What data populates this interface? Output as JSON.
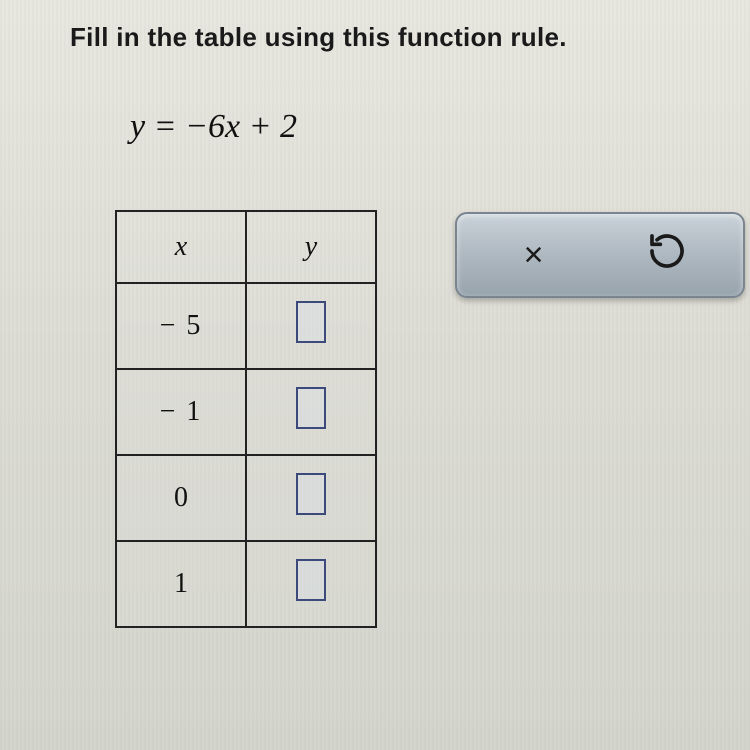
{
  "instruction": "Fill in the table using this function rule.",
  "equation": "y = −6x + 2",
  "table": {
    "headers": {
      "x": "x",
      "y": "y"
    },
    "rows": [
      {
        "x": "− 5",
        "y": ""
      },
      {
        "x": "− 1",
        "y": ""
      },
      {
        "x": "0",
        "y": ""
      },
      {
        "x": "1",
        "y": ""
      }
    ]
  },
  "toolbar": {
    "close_label": "×",
    "reset_label": "↺"
  },
  "chart_data": {
    "type": "table",
    "title": "Function table for y = -6x + 2",
    "columns": [
      "x",
      "y"
    ],
    "rows": [
      {
        "x": -5,
        "y": null
      },
      {
        "x": -1,
        "y": null
      },
      {
        "x": 0,
        "y": null
      },
      {
        "x": 1,
        "y": null
      }
    ]
  }
}
